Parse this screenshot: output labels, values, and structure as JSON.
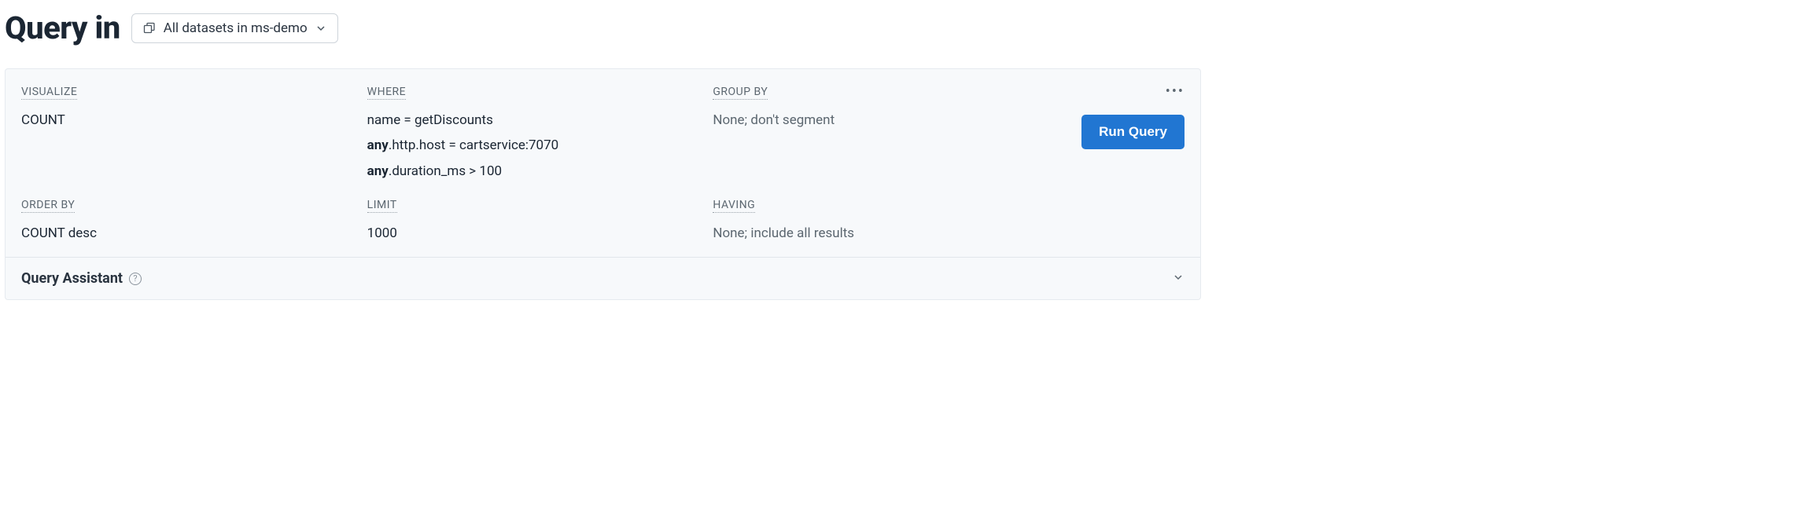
{
  "header": {
    "title": "Query in",
    "dataset_label": "All datasets in ms-demo"
  },
  "query": {
    "visualize": {
      "label": "VISUALIZE",
      "value": "COUNT"
    },
    "where": {
      "label": "WHERE",
      "clauses": [
        {
          "prefix": "",
          "text": "name = getDiscounts"
        },
        {
          "prefix": "any",
          "text": ".http.host = cartservice:7070"
        },
        {
          "prefix": "any",
          "text": ".duration_ms > 100"
        }
      ]
    },
    "group_by": {
      "label": "GROUP BY",
      "placeholder": "None; don't segment"
    },
    "order_by": {
      "label": "ORDER BY",
      "value": "COUNT desc"
    },
    "limit": {
      "label": "LIMIT",
      "value": "1000"
    },
    "having": {
      "label": "HAVING",
      "placeholder": "None; include all results"
    }
  },
  "actions": {
    "run_label": "Run Query"
  },
  "assistant": {
    "title": "Query Assistant"
  }
}
